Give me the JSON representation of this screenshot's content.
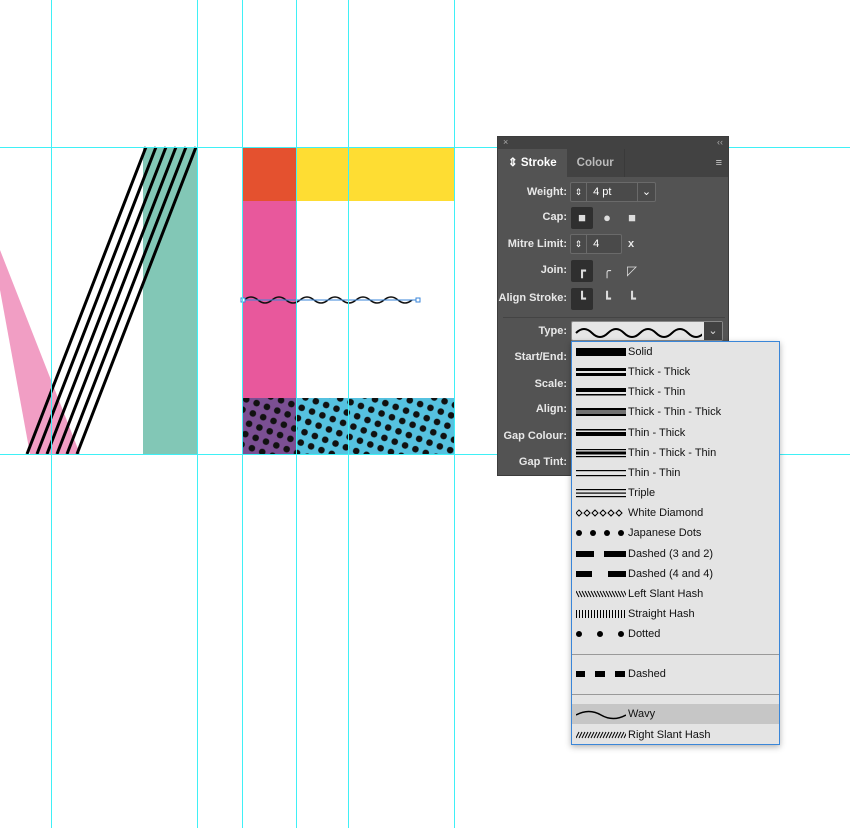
{
  "colors": {
    "guide": "#3ff0f6",
    "orange": "#e4512f",
    "yellow": "#fedd33",
    "pink": "#e8589c",
    "lightpink": "#f19ec4",
    "teal": "#82c7b6",
    "blue": "#56c2e0",
    "purple": "#7b4f93",
    "highlight": "#3a86d8"
  },
  "panel": {
    "close_icon": "×",
    "collapse_icon": "‹‹",
    "tabs": [
      {
        "label": "Stroke",
        "active": true
      },
      {
        "label": "Colour",
        "active": false
      }
    ],
    "menu_icon": "≡",
    "weight": {
      "label": "Weight:",
      "value": "4 pt"
    },
    "cap": {
      "label": "Cap:",
      "options": [
        "butt-cap",
        "round-cap",
        "projecting-cap"
      ],
      "selected": 0
    },
    "mitre": {
      "label": "Mitre Limit:",
      "value": "4",
      "suffix": "x"
    },
    "join": {
      "label": "Join:",
      "options": [
        "mitre-join",
        "round-join",
        "bevel-join"
      ],
      "selected": 0
    },
    "align": {
      "label": "Align Stroke:",
      "options": [
        "center",
        "inside",
        "outside"
      ],
      "selected": 0
    },
    "type": {
      "label": "Type:",
      "value": "Wavy"
    },
    "start_end": {
      "label": "Start/End:"
    },
    "scale": {
      "label": "Scale:"
    },
    "align2": {
      "label": "Align:"
    },
    "gap_colour": {
      "label": "Gap Colour:"
    },
    "gap_tint": {
      "label": "Gap Tint:"
    }
  },
  "dropdown": {
    "items": [
      {
        "label": "Solid",
        "style": "solid"
      },
      {
        "label": "Thick - Thick",
        "style": "tt"
      },
      {
        "label": "Thick - Thin",
        "style": "tk"
      },
      {
        "label": "Thick - Thin - Thick",
        "style": "ttt"
      },
      {
        "label": "Thin - Thick",
        "style": "tn"
      },
      {
        "label": "Thin - Thick - Thin",
        "style": "tnt"
      },
      {
        "label": "Thin - Thin",
        "style": "nn"
      },
      {
        "label": "Triple",
        "style": "triple"
      },
      {
        "label": "White Diamond",
        "style": "diamond"
      },
      {
        "label": "Japanese Dots",
        "style": "jdots"
      },
      {
        "label": "Dashed (3 and 2)",
        "style": "d32"
      },
      {
        "label": "Dashed (4 and 4)",
        "style": "d44"
      },
      {
        "label": "Left Slant Hash",
        "style": "lhash"
      },
      {
        "label": "Straight Hash",
        "style": "shash"
      },
      {
        "label": "Dotted",
        "style": "dotted"
      },
      {
        "label": "Dashed",
        "style": "dashed"
      },
      {
        "label": "Wavy",
        "style": "wavy"
      },
      {
        "label": "Right Slant Hash",
        "style": "rhash"
      }
    ],
    "selected": "Wavy"
  }
}
